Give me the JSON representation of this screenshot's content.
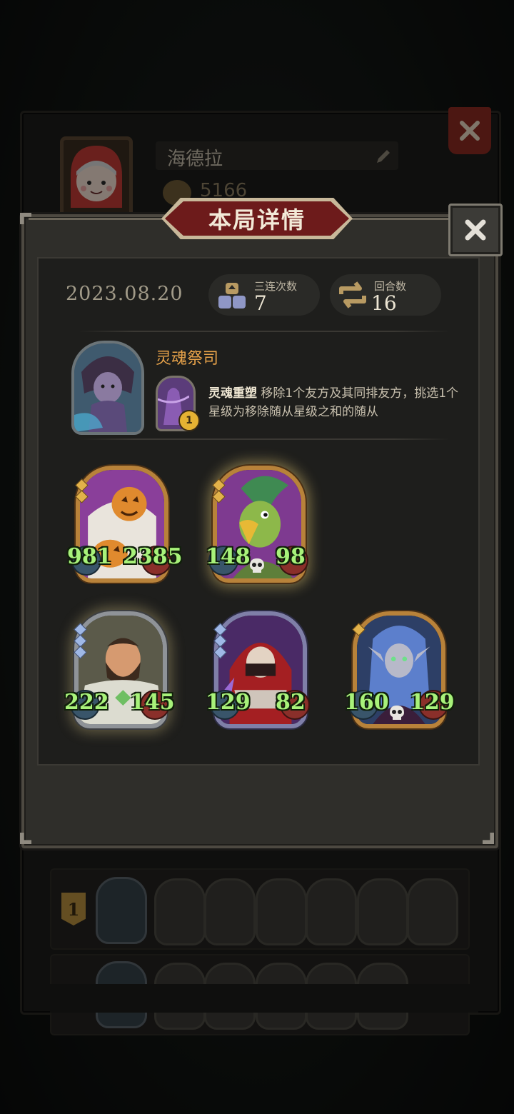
{
  "player": {
    "name": "海德拉",
    "coins": "5166"
  },
  "modal": {
    "title": "本局详情",
    "date": "2023.08.20",
    "triples_label": "三连次数",
    "triples_value": "7",
    "turns_label": "回合数",
    "turns_value": "16"
  },
  "hero": {
    "name": "灵魂祭司",
    "power_name": "灵魂重塑",
    "power_description": "移除1个友方及其同排友方，挑选1个星级为移除随从星级之和的随从",
    "power_cost": "1"
  },
  "minions": [
    {
      "name": "pumpkin-minion",
      "attack": "981",
      "health": "2385"
    },
    {
      "name": "vulture-minion",
      "attack": "148",
      "health": "98"
    },
    {
      "name": "brawler-minion",
      "attack": "222",
      "health": "145"
    },
    {
      "name": "assassin-minion",
      "attack": "129",
      "health": "82"
    },
    {
      "name": "elf-witch-minion",
      "attack": "160",
      "health": "129"
    }
  ],
  "history": {
    "rows": [
      {
        "rank": "1"
      },
      {
        "rank": ""
      }
    ]
  },
  "colors": {
    "accent_orange": "#e8a34a",
    "stat_green": "#a8f27a",
    "title_red": "#6d1b1b"
  }
}
